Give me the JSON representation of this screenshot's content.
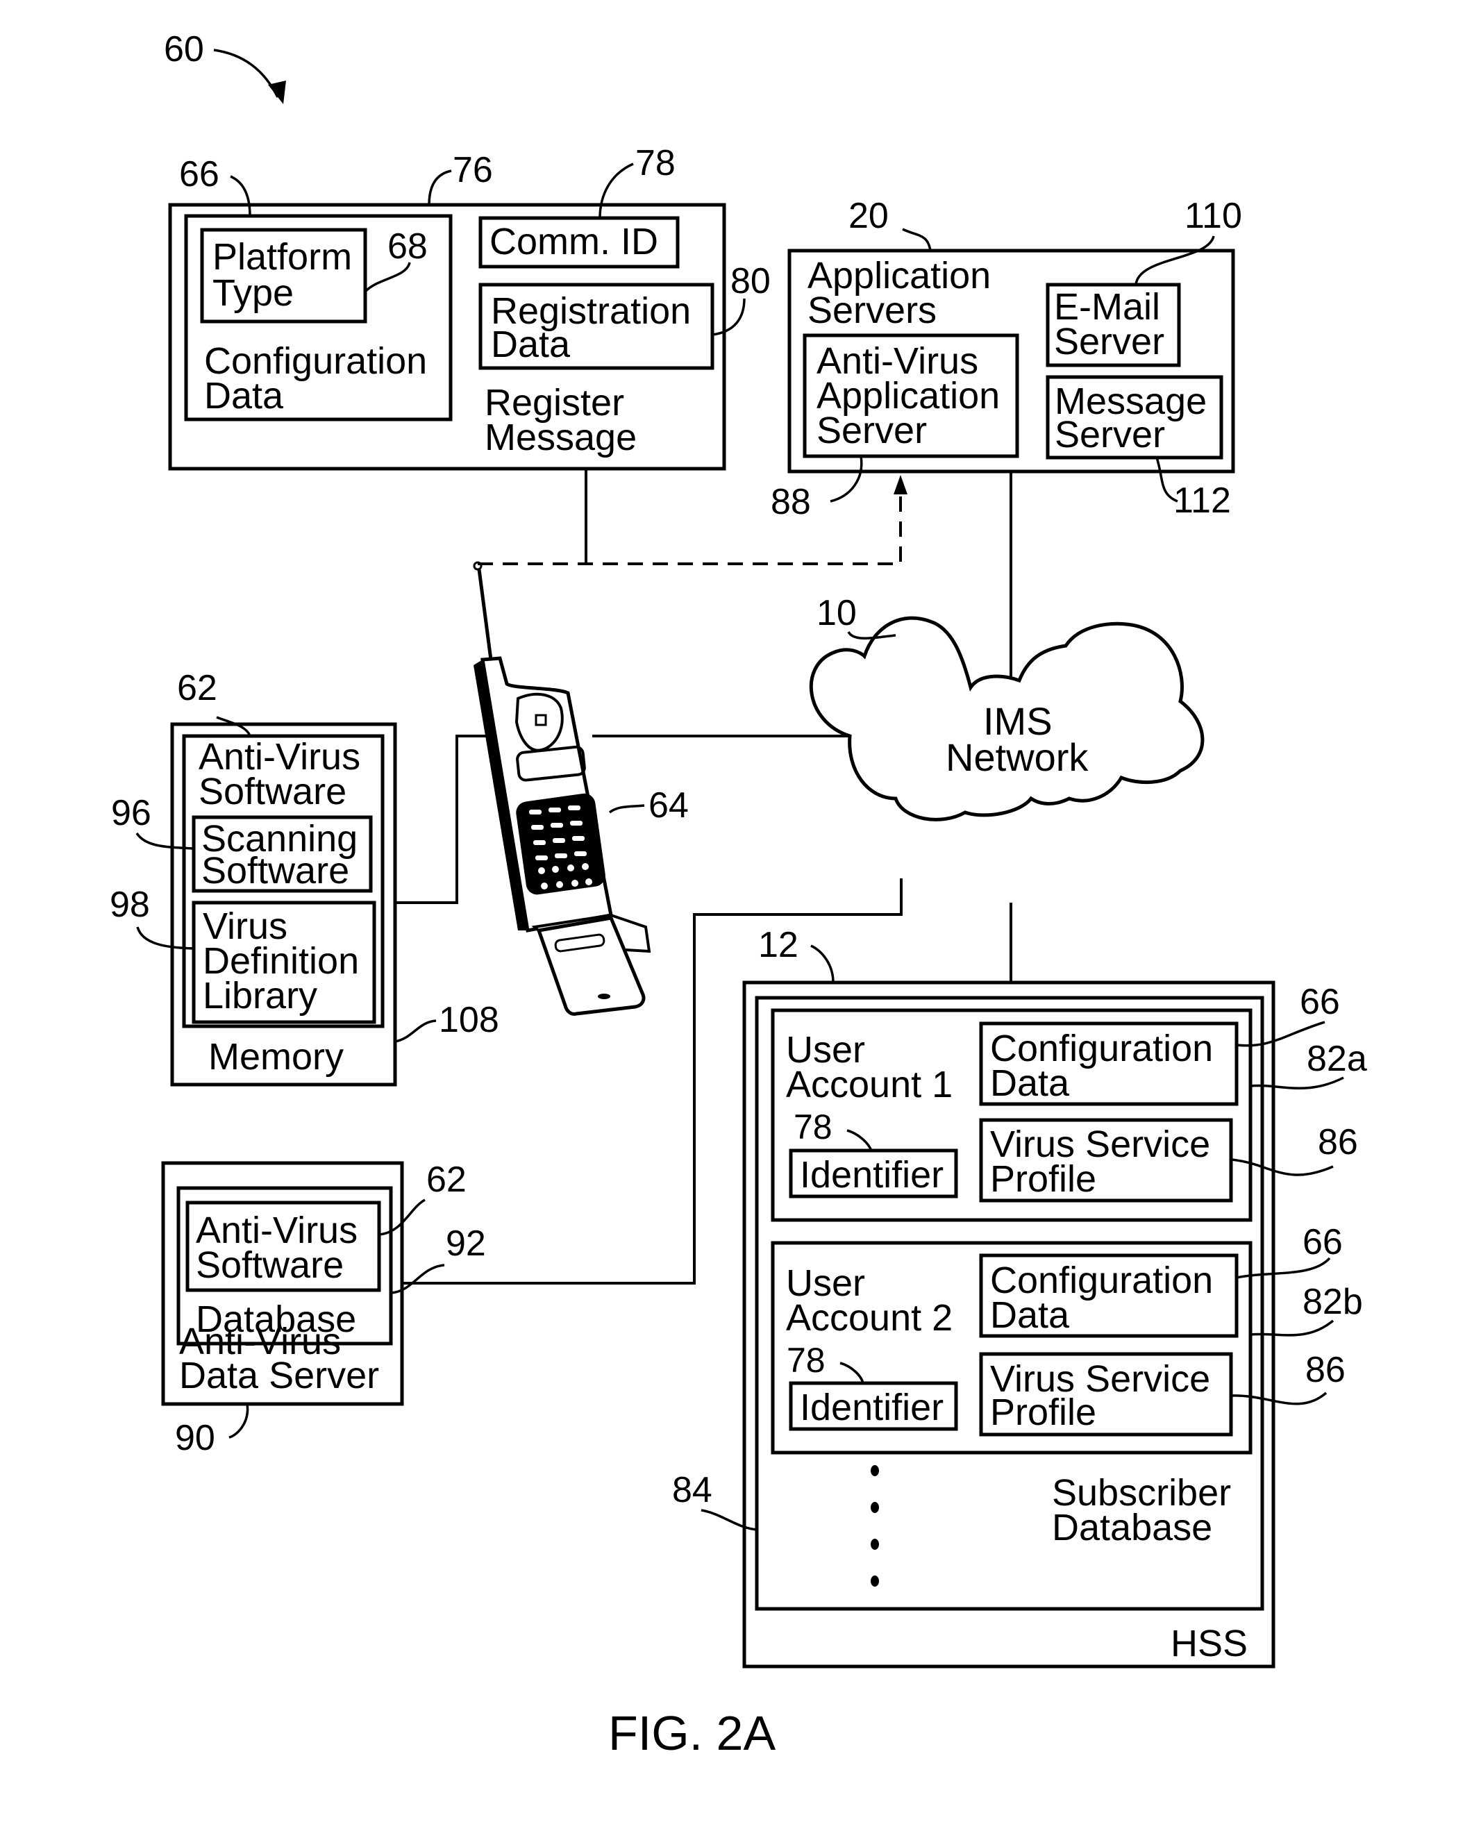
{
  "figure": {
    "caption": "FIG. 2A",
    "ref_system": "60"
  },
  "register_message": {
    "ref": "76",
    "label_line1": "Register",
    "label_line2": "Message",
    "configuration_data": {
      "ref": "66",
      "line1": "Configuration",
      "line2": "Data"
    },
    "platform_type": {
      "ref": "68",
      "line1": "Platform",
      "line2": "Type"
    },
    "comm_id": {
      "ref": "78",
      "label": "Comm. ID"
    },
    "registration_data": {
      "ref": "80",
      "line1": "Registration",
      "line2": "Data"
    }
  },
  "application_servers": {
    "ref": "20",
    "line1": "Application",
    "line2": "Servers",
    "anti_virus_app_server": {
      "ref": "88",
      "line1": "Anti-Virus",
      "line2": "Application",
      "line3": "Server"
    },
    "email_server": {
      "ref": "110",
      "line1": "E-Mail",
      "line2": "Server"
    },
    "message_server": {
      "ref": "112",
      "line1": "Message",
      "line2": "Server"
    }
  },
  "mobile_device": {
    "ref": "64"
  },
  "ims_network": {
    "ref": "10",
    "line1": "IMS",
    "line2": "Network"
  },
  "memory": {
    "ref": "108",
    "label": "Memory",
    "anti_virus_software": {
      "ref": "62",
      "line1": "Anti-Virus",
      "line2": "Software"
    },
    "scanning_software": {
      "ref": "96",
      "line1": "Scanning",
      "line2": "Software"
    },
    "virus_definition_library": {
      "ref": "98",
      "line1": "Virus",
      "line2": "Definition",
      "line3": "Library"
    }
  },
  "anti_virus_data_server": {
    "ref": "90",
    "line1": "Anti-Virus",
    "line2": "Data Server",
    "database": {
      "ref": "92",
      "label": "Database"
    },
    "anti_virus_software": {
      "ref": "62",
      "line1": "Anti-Virus",
      "line2": "Software"
    }
  },
  "hss": {
    "ref": "12",
    "label": "HSS",
    "subscriber_database": {
      "ref": "84",
      "line1": "Subscriber",
      "line2": "Database"
    },
    "accounts": [
      {
        "ref": "82a",
        "line1": "User",
        "line2": "Account 1",
        "identifier": {
          "ref": "78",
          "label": "Identifier"
        },
        "configuration_data": {
          "ref": "66",
          "line1": "Configuration",
          "line2": "Data"
        },
        "virus_service_profile": {
          "ref": "86",
          "line1": "Virus Service",
          "line2": "Profile"
        }
      },
      {
        "ref": "82b",
        "line1": "User",
        "line2": "Account 2",
        "identifier": {
          "ref": "78",
          "label": "Identifier"
        },
        "configuration_data": {
          "ref": "66",
          "line1": "Configuration",
          "line2": "Data"
        },
        "virus_service_profile": {
          "ref": "86",
          "line1": "Virus Service",
          "line2": "Profile"
        }
      }
    ]
  }
}
